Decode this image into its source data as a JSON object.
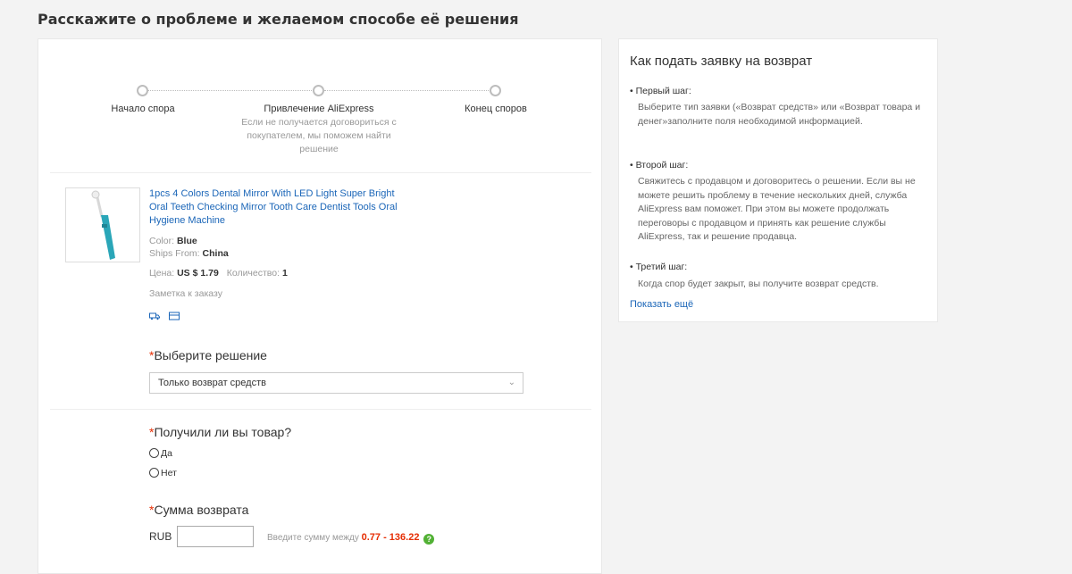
{
  "page_title": "Расскажите о проблеме и желаемом способе её решения",
  "steps": [
    {
      "label": "Начало спора"
    },
    {
      "label": "Привлечение AliExpress",
      "description": "Если не получается договориться с покупателем, мы поможем найти решение"
    },
    {
      "label": "Конец споров"
    }
  ],
  "product": {
    "title": "1pcs 4 Colors Dental Mirror With LED Light Super Bright Oral Teeth Checking Mirror Tooth Care Dentist Tools Oral Hygiene Machine",
    "color_label": "Color:",
    "color_value": "Blue",
    "ships_label": "Ships From:",
    "ships_value": "China",
    "price_label": "Цена:",
    "price_value": "US $ 1.79",
    "qty_label": "Количество:",
    "qty_value": "1",
    "note_label": "Заметка к заказу",
    "icons": [
      "truck-icon",
      "card-icon"
    ],
    "thumb_color": "#2aa6b8"
  },
  "solution": {
    "required_mark": "*",
    "label": "Выберите решение",
    "selected": "Только возврат средств"
  },
  "received": {
    "required_mark": "*",
    "label": "Получили ли вы товар?",
    "options": [
      "Да",
      "Нет"
    ]
  },
  "refund": {
    "required_mark": "*",
    "label": "Сумма возврата",
    "currency": "RUB",
    "value": "",
    "hint_prefix": "Введите сумму между",
    "range": "0.77 - 136.22",
    "help": "?"
  },
  "side": {
    "title": "Как подать заявку на возврат",
    "steps": [
      {
        "title": "• Первый шаг:",
        "text": "Выберите тип заявки («Возврат средств» или «Возврат товара и денег»заполните поля необходимой информацией."
      },
      {
        "title": "• Второй шаг:",
        "text": "Свяжитесь с продавцом и договоритесь о решении. Если вы не можете решить проблему в течение нескольких дней, служба AliExpress вам поможет. При этом вы можете продолжать переговоры с продавцом и принять как решение службы AliExpress, так и решение продавца."
      },
      {
        "title": "• Третий шаг:",
        "text": "Когда спор будет закрыт, вы получите возврат средств."
      }
    ],
    "more_link": "Показать ещё"
  },
  "colors": {
    "link": "#1b66b8",
    "required": "#e62e04",
    "help_green": "#52b135"
  }
}
